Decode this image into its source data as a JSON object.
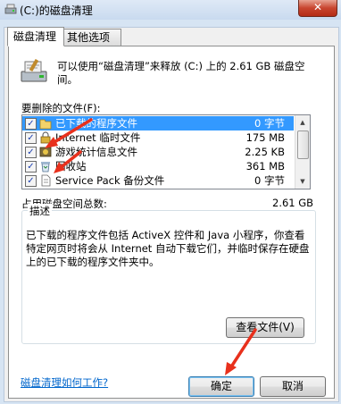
{
  "window": {
    "title": "(C:)的磁盘清理",
    "close_glyph": "✕"
  },
  "tabs": [
    {
      "label": "磁盘清理"
    },
    {
      "label": "其他选项"
    }
  ],
  "intro": {
    "text": "可以使用“磁盘清理”来释放  (C:) 上的 2.61 GB 磁盘空间。"
  },
  "files": {
    "label": "要删除的文件(F):",
    "items": [
      {
        "name": "已下载的程序文件",
        "size": "0 字节",
        "checked": true,
        "selected": true,
        "icon": "folder-icon"
      },
      {
        "name": "Internet 临时文件",
        "size": "175 MB",
        "checked": true,
        "selected": false,
        "icon": "internet-lock-icon"
      },
      {
        "name": "游戏统计信息文件",
        "size": "2.25 KB",
        "checked": true,
        "selected": false,
        "icon": "game-icon"
      },
      {
        "name": "回收站",
        "size": "361 MB",
        "checked": true,
        "selected": false,
        "icon": "recycle-bin-icon"
      },
      {
        "name": "Service Pack 备份文件",
        "size": "0 字节",
        "checked": true,
        "selected": false,
        "icon": "file-icon"
      }
    ],
    "check_glyph": "✓",
    "scroll_up": "▲",
    "scroll_down": "▼"
  },
  "total": {
    "label": "占用磁盘空间总数:",
    "value": "2.61 GB"
  },
  "description": {
    "title": "描述",
    "text": "已下载的程序文件包括 ActiveX 控件和 Java 小程序，你查看特定网页时将会从 Internet 自动下载它们，并临时保存在硬盘上的已下载的程序文件夹中。"
  },
  "buttons": {
    "view_files": "查看文件(V)",
    "ok": "确定",
    "cancel": "取消"
  },
  "help_link": "磁盘清理如何工作?",
  "colors": {
    "selection": "#3399ff",
    "annotation_arrow": "#e8301c",
    "link": "#0066cc"
  }
}
